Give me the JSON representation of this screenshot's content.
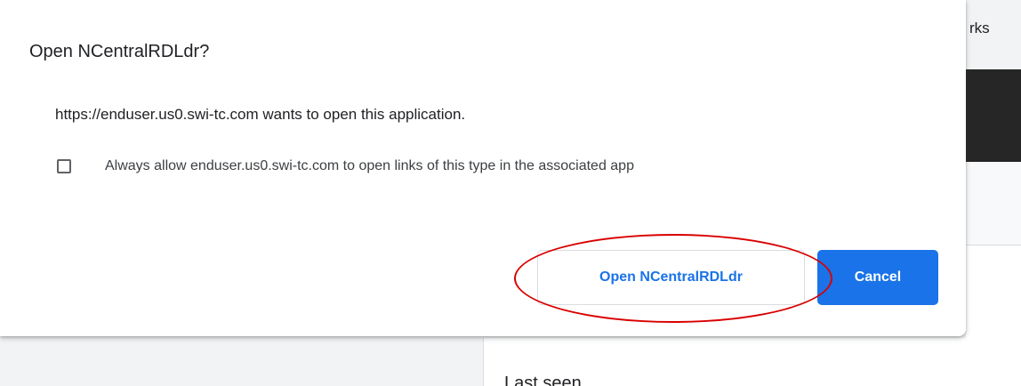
{
  "background": {
    "bookmarks_fragment": "rks",
    "last_seen_fragment": "Last seen"
  },
  "dialog": {
    "title": "Open NCentralRDLdr?",
    "message": "https://enduser.us0.swi-tc.com wants to open this application.",
    "checkbox_label": "Always allow enduser.us0.swi-tc.com to open links of this type in the associated app",
    "checkbox_checked": false,
    "open_button_label": "Open NCentralRDLdr",
    "cancel_button_label": "Cancel"
  },
  "colors": {
    "primary_blue": "#1a73e8",
    "annotation_red": "#d90000"
  }
}
